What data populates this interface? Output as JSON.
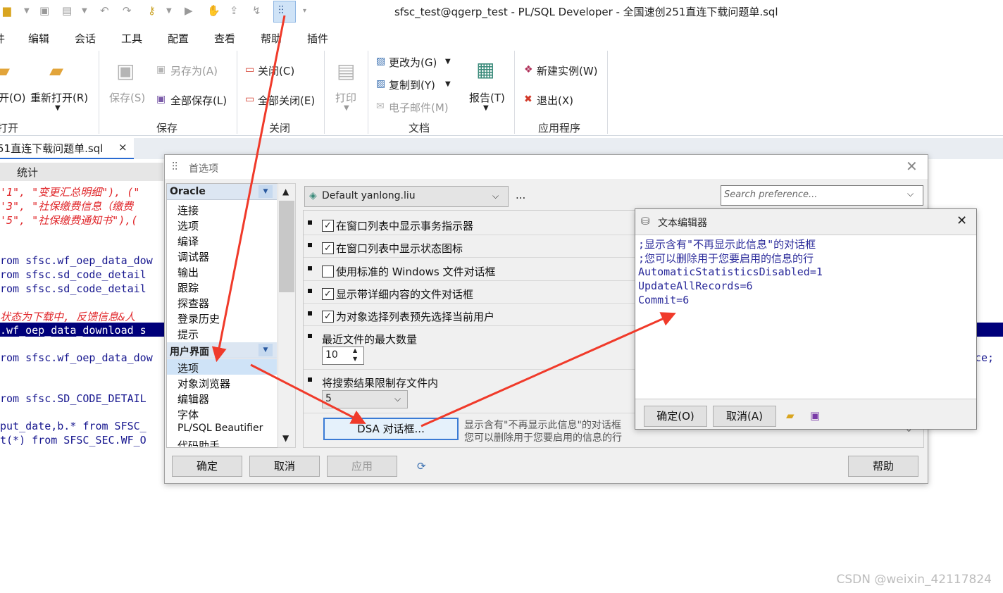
{
  "window": {
    "title": "sfsc_test@qgerp_test - PL/SQL Developer - 全国速创251直连下载问题单.sql"
  },
  "menu": [
    "件",
    "编辑",
    "会话",
    "工具",
    "配置",
    "查看",
    "帮助",
    "插件"
  ],
  "ribbon": {
    "open_partial": "开(O)",
    "reopen": "重新打开(R)",
    "open_group": "打开",
    "save": "保存(S)",
    "save_as": "另存为(A)",
    "save_all": "全部保存(L)",
    "save_group": "保存",
    "close": "关闭(C)",
    "close_all": "全部关闭(E)",
    "close_group": "关闭",
    "print": "打印",
    "change_to": "更改为(G)",
    "copy_to": "复制到(Y)",
    "email": "电子邮件(M)",
    "report": "报告(T)",
    "doc_group": "文档",
    "new_instance": "新建实例(W)",
    "exit": "退出(X)",
    "app_group": "应用程序"
  },
  "doc_tab": {
    "label": "51直连下载问题单.sql",
    "close": "×"
  },
  "stats_label": "统计",
  "code_lines": [
    "'1\", \"变更汇总明细\"), (\"",
    "'3\", \"社保缴费信息（缴费",
    "'5\", \"社保缴费通知书\"),(",
    "rom sfsc.wf_oep_data_dow",
    "rom sfsc.sd_code_detail",
    "rom sfsc.sd_code_detail",
    "状态为下载中, 反馈信息&人",
    ".wf_oep_data_download s",
    "rom sfsc.wf_oep_data_dow",
    "rom sfsc.SD_CODE_DETAIL",
    "put_date,b.* from SFSC_",
    "t(*) from SFSC_SEC.WF_O",
    "ce;"
  ],
  "prefs": {
    "title": "首选项",
    "tree_header_oracle": "Oracle",
    "oracle_items": [
      "连接",
      "选项",
      "编译",
      "调试器",
      "输出",
      "跟踪",
      "探查器",
      "登录历史",
      "提示"
    ],
    "tree_header_ui": "用户界面",
    "ui_items": [
      "选项",
      "对象浏览器",
      "编辑器",
      "字体",
      "PL/SQL Beautifier",
      "代码助手"
    ],
    "profile": "Default yanlong.liu",
    "profile_more": "...",
    "search_placeholder": "Search preference...",
    "options": [
      {
        "label": "在窗口列表中显示事务指示器",
        "checked": "✓"
      },
      {
        "label": "在窗口列表中显示状态图标",
        "checked": "✓"
      },
      {
        "label": "使用标准的 Windows 文件对话框",
        "checked": ""
      },
      {
        "label": "显示带详细内容的文件对话框",
        "checked": "✓"
      },
      {
        "label": "为对象选择列表预先选择当前用户",
        "checked": "✓"
      }
    ],
    "max_recent_label": "最近文件的最大数量",
    "max_recent_value": "10",
    "limit_search_label": "将搜索结果限制存文件内",
    "limit_search_value": "5",
    "dsa_button": "DSA 对话框...",
    "dsa_desc_1": "显示含有\"不再显示此信息\"的对话框",
    "dsa_desc_2": "您可以删除用于您要启用的信息的行",
    "ok": "确定",
    "cancel": "取消",
    "apply": "应用",
    "help": "帮助"
  },
  "text_editor": {
    "title": "文本编辑器",
    "lines": [
      ";显示含有\"不再显示此信息\"的对话框",
      ";您可以删除用于您要启用的信息的行",
      "AutomaticStatisticsDisabled=1",
      "UpdateAllRecords=6",
      "Commit=6"
    ],
    "ok": "确定(O)",
    "cancel": "取消(A)"
  },
  "watermark": "CSDN @weixin_42117824",
  "colors": {
    "arrow": "#f03a2a",
    "highlight_row": "#00007a",
    "tree_selected": "#cfe3f7"
  }
}
